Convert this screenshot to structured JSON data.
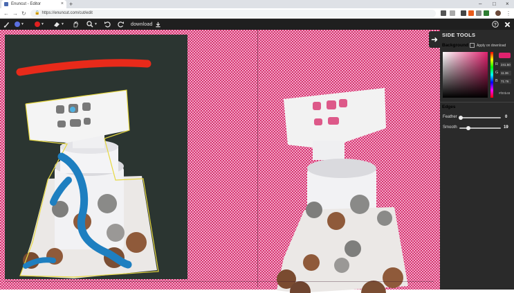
{
  "browser": {
    "tab_title": "Enuncut - Editor",
    "tab_close": "×",
    "new_tab": "+",
    "minimize": "–",
    "maximize": "□",
    "close": "×",
    "url": "https://enuncut.com/cut/edit",
    "back": "←",
    "forward": "→",
    "reload": "↻"
  },
  "toolbar": {
    "download_label": "download",
    "brush_color": "#5b6fe0",
    "mark_color": "#e02020",
    "caret": "▼"
  },
  "side_panel": {
    "title": "SIDE TOOLS",
    "background_label": "Background",
    "apply_on_download": "Apply on download",
    "selected_color": "#e0226e",
    "channels": [
      {
        "name": "R",
        "value": "241.50"
      },
      {
        "name": "G",
        "value": "11.36"
      },
      {
        "name": "B",
        "value": "71.76"
      }
    ],
    "hex": "#f00b48",
    "edges_label": "Edges",
    "feather": {
      "label": "Feather",
      "value": "0",
      "level": 0
    },
    "smooth": {
      "label": "Smooth",
      "value": "19",
      "level": 0.19
    }
  },
  "colors": {
    "checker_dark": "#d8336f",
    "checker_light": "#f0a8c8",
    "toolbar_bg": "#1f1f1f",
    "panel_bg": "#2a2a2a"
  }
}
